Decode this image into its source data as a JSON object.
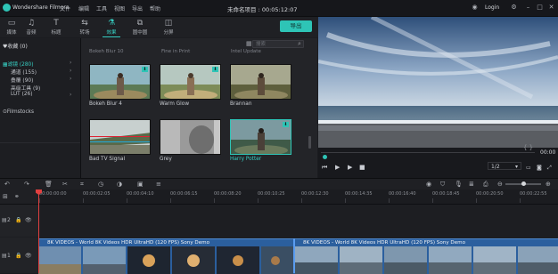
{
  "app": {
    "name": "Wondershare Filmora",
    "menus": [
      "文件",
      "编辑",
      "工具",
      "视图",
      "导出",
      "帮助"
    ],
    "project_title": "未命名项目 : 00:05:12:07",
    "login": "Login"
  },
  "toolbar": {
    "tabs": [
      {
        "label": "媒体",
        "icon": "folder-icon"
      },
      {
        "label": "音频",
        "icon": "music-icon"
      },
      {
        "label": "标题",
        "icon": "title-icon"
      },
      {
        "label": "转场",
        "icon": "transition-icon"
      },
      {
        "label": "效果",
        "icon": "effects-icon",
        "active": true
      },
      {
        "label": "圆中圆",
        "icon": "pip-icon"
      },
      {
        "label": "分屏",
        "icon": "split-screen-icon"
      }
    ],
    "export_label": "导出"
  },
  "sidebar": {
    "favorites": "♥收藏 (0)",
    "items": [
      {
        "label": "滤镜 (280)",
        "active": true
      },
      {
        "label": "通道 (155)"
      },
      {
        "label": "叠覆 (90)"
      },
      {
        "label": "高级工具 (9)"
      },
      {
        "label": "LUT (26)"
      }
    ],
    "filmstocks": "Filmstocks"
  },
  "library": {
    "search_placeholder": "搜索",
    "top_captions": [
      "Bokeh Blur 10",
      "Fine in Print",
      "Intel Update"
    ],
    "effects": [
      {
        "name": "Bokeh Blur 4",
        "download": true
      },
      {
        "name": "Warm Glow",
        "download": true
      },
      {
        "name": "Brannan",
        "download": false
      },
      {
        "name": "Bad TV Signal",
        "download": false
      },
      {
        "name": "Grey",
        "download": false
      },
      {
        "name": "Harry Potter",
        "download": true,
        "selected": true
      }
    ]
  },
  "preview": {
    "timecode": "00:00",
    "ratio": "1/2"
  },
  "timeline": {
    "ruler": [
      "00:00:00:00",
      "00:00:02:05",
      "00:00:04:10",
      "00:00:06:15",
      "00:00:08:20",
      "00:00:10:25",
      "00:00:12:30",
      "00:00:14:35",
      "00:00:16:40",
      "00:00:18:45",
      "00:00:20:50",
      "00:00:22:55"
    ],
    "track_labels": [
      "2",
      "1"
    ],
    "clip_labels": [
      "8K VIDEOS - World 8K Videos HDR UltraHD (120 FPS) Sony Demo",
      "8K VIDEOS - World 8K Videos HDR UltraHD (120 FPS) Sony Demo"
    ]
  },
  "colors": {
    "accent": "#2ec4b6",
    "playhead": "#e04040",
    "clip": "#2b5f9e"
  }
}
